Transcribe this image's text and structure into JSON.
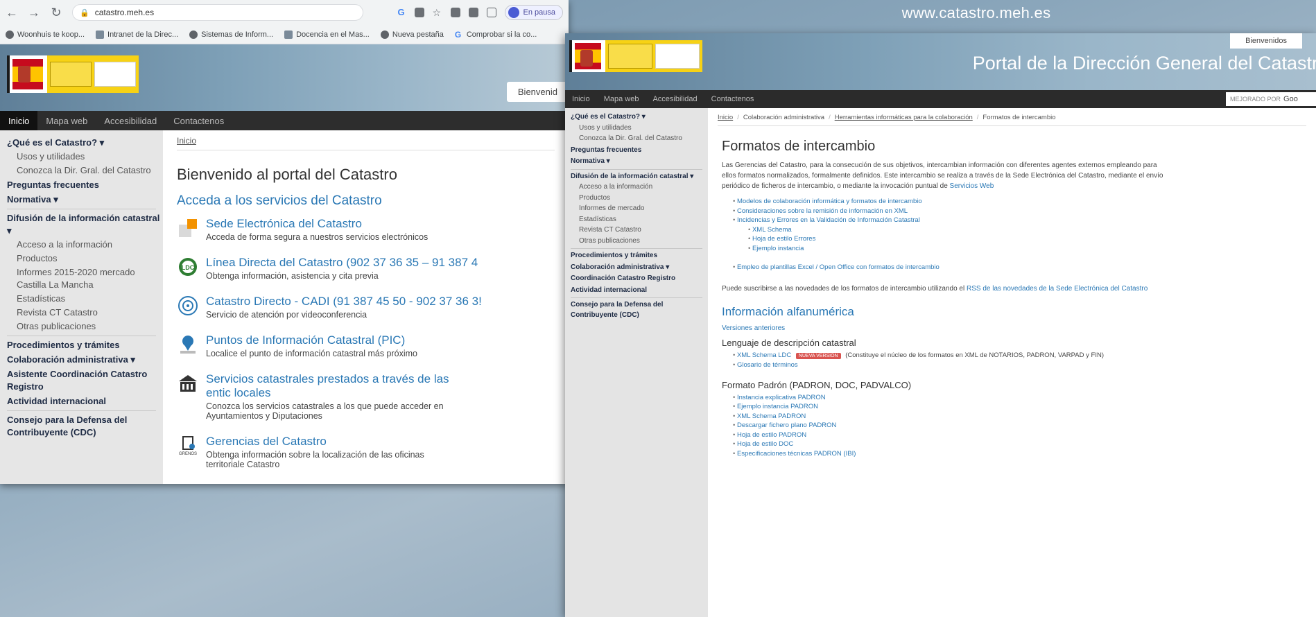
{
  "site_url": "www.catastro.meh.es",
  "browser": {
    "address": "catastro.meh.es",
    "profile_label": "En pausa",
    "bookmarks": [
      {
        "label": "Woonhuis te koop...",
        "icon": "globe-icon"
      },
      {
        "label": "Intranet de la Direc...",
        "icon": "intranet-icon"
      },
      {
        "label": "Sistemas de Inform...",
        "icon": "globe-icon"
      },
      {
        "label": "Docencia en el Mas...",
        "icon": "docencia-icon"
      },
      {
        "label": "Nueva pestaña",
        "icon": "globe-icon"
      },
      {
        "label": "Comprobar si la co...",
        "icon": "google-icon"
      }
    ]
  },
  "left_page": {
    "welcome_tab": "Bienvenid",
    "nav": [
      "Inicio",
      "Mapa web",
      "Accesibilidad",
      "Contactenos"
    ],
    "sidebar": [
      {
        "label": "¿Qué es el Catastro? ▾",
        "type": "heading"
      },
      {
        "label": "Usos y utilidades",
        "type": "sub"
      },
      {
        "label": "Conozca la Dir. Gral. del Catastro",
        "type": "sub"
      },
      {
        "label": "Preguntas frecuentes",
        "type": "heading"
      },
      {
        "label": "Normativa ▾",
        "type": "heading"
      },
      {
        "label": "",
        "type": "sep"
      },
      {
        "label": "Difusión de la información catastral ▾",
        "type": "heading"
      },
      {
        "label": "Acceso a la información",
        "type": "sub"
      },
      {
        "label": "Productos",
        "type": "sub"
      },
      {
        "label": "Informes 2015-2020 mercado Castilla La Mancha",
        "type": "sub"
      },
      {
        "label": "Estadísticas",
        "type": "sub"
      },
      {
        "label": "Revista CT Catastro",
        "type": "sub"
      },
      {
        "label": "Otras publicaciones",
        "type": "sub"
      },
      {
        "label": "",
        "type": "sep"
      },
      {
        "label": "Procedimientos y trámites",
        "type": "heading"
      },
      {
        "label": "Colaboración administrativa ▾",
        "type": "heading"
      },
      {
        "label": "Asistente Coordinación Catastro Registro",
        "type": "heading"
      },
      {
        "label": "Actividad internacional",
        "type": "heading"
      },
      {
        "label": "",
        "type": "sep"
      },
      {
        "label": "Consejo para la Defensa del Contribuyente (CDC)",
        "type": "heading"
      }
    ],
    "breadcrumb": "Inicio",
    "title": "Bienvenido al portal del Catastro",
    "subtitle": "Acceda a los servicios del Catastro",
    "services": [
      {
        "title": "Sede Electrónica del Catastro",
        "desc": "Acceda de forma segura a nuestros servicios electrónicos",
        "icon": "sede-icon"
      },
      {
        "title": "Línea Directa del Catastro (902 37 36 35 – 91 387 4",
        "desc": "Obtenga información, asistencia y cita previa",
        "icon": "ldc-icon"
      },
      {
        "title": "Catastro Directo - CADI (91 387 45 50 - 902 37 36 3!",
        "desc": "Servicio de atención por videoconferencia",
        "icon": "cadi-icon"
      },
      {
        "title": "Puntos de Información Catastral (PIC)",
        "desc": "Localice el punto de información catastral más próximo",
        "icon": "pic-icon"
      },
      {
        "title": "Servicios catastrales prestados a través de las entic locales",
        "desc": "Conozca los servicios catastrales a los que puede acceder en Ayuntamientos y Diputaciones",
        "icon": "building-icon",
        "wrap": true
      },
      {
        "title": "Gerencias del Catastro",
        "desc": "Obtenga información sobre la localización de las oficinas territoriale Catastro",
        "icon": "gerencias-icon",
        "wrap": true
      }
    ]
  },
  "right_page": {
    "welcome_tab": "Bienvenidos",
    "portal_title": "Portal de la Dirección General del Catastro",
    "nav": [
      "Inicio",
      "Mapa web",
      "Accesibilidad",
      "Contactenos"
    ],
    "search_label": "MEJORADO POR",
    "search_brand": "Goo",
    "sidebar": [
      {
        "label": "¿Qué es el Catastro? ▾",
        "type": "heading"
      },
      {
        "label": "Usos y utilidades",
        "type": "sub"
      },
      {
        "label": "Conozca la Dir. Gral. del Catastro",
        "type": "sub"
      },
      {
        "label": "Preguntas frecuentes",
        "type": "heading"
      },
      {
        "label": "Normativa ▾",
        "type": "heading"
      },
      {
        "label": "",
        "type": "sep"
      },
      {
        "label": "Difusión de la información catastral ▾",
        "type": "heading"
      },
      {
        "label": "Acceso a la información",
        "type": "sub"
      },
      {
        "label": "Productos",
        "type": "sub"
      },
      {
        "label": "Informes de mercado",
        "type": "sub"
      },
      {
        "label": "Estadísticas",
        "type": "sub"
      },
      {
        "label": "Revista CT Catastro",
        "type": "sub"
      },
      {
        "label": "Otras publicaciones",
        "type": "sub"
      },
      {
        "label": "",
        "type": "sep"
      },
      {
        "label": "Procedimientos y trámites",
        "type": "heading"
      },
      {
        "label": "Colaboración administrativa ▾",
        "type": "heading"
      },
      {
        "label": "Coordinación Catastro Registro",
        "type": "heading"
      },
      {
        "label": "Actividad internacional",
        "type": "heading"
      },
      {
        "label": "",
        "type": "sep"
      },
      {
        "label": "Consejo para la Defensa del Contribuyente (CDC)",
        "type": "heading"
      }
    ],
    "breadcrumbs": [
      "Inicio",
      "Colaboración administrativa",
      "Herramientas informáticas para la colaboración",
      "Formatos de intercambio"
    ],
    "title": "Formatos de intercambio",
    "intro": "Las Gerencias del Catastro, para la consecución de sus objetivos, intercambian información con diferentes agentes externos empleando para ellos formatos normalizados, formalmente definidos. Este intercambio se realiza a través de la Sede Electrónica del Catastro, mediante el envío periódico de ficheros de intercambio, o mediante la invocación puntual de",
    "intro_link": "Servicios Web",
    "links1": [
      {
        "label": "Modelos de colaboración informática y formatos de intercambio",
        "sub": false
      },
      {
        "label": "Consideraciones sobre la remisión de información en XML",
        "sub": false
      },
      {
        "label": "Incidencias y Errores en la Validación de Información Catastral",
        "sub": false
      },
      {
        "label": "XML Schema",
        "sub": true
      },
      {
        "label": "Hoja de estilo Errores",
        "sub": true
      },
      {
        "label": "Ejemplo instancia",
        "sub": true
      }
    ],
    "link_excel": "Empleo de plantillas Excel / Open Office con formatos de intercambio",
    "subscribe_pre": "Puede suscribirse a las novedades de los formatos de intercambio utilizando el",
    "subscribe_link": "RSS de las novedades de la Sede Electrónica del Catastro",
    "h2": "Información alfanumérica",
    "versions_link": "Versiones anteriores",
    "h3_ldc": "Lenguaje de descripción catastral",
    "ldc_link": "XML Schema LDC",
    "badge": "NUEVA VERSIÓN",
    "ldc_desc": "(Constituye el núcleo de los formatos en XML de NOTARIOS, PADRON, VARPAD y FIN)",
    "glosario": "Glosario de términos",
    "h3_padron": "Formato Padrón (PADRON, DOC, PADVALCO)",
    "padron_links": [
      "Instancia explicativa PADRON",
      "Ejemplo instancia PADRON",
      "XML Schema PADRON",
      "Descargar fichero plano PADRON",
      "Hoja de estilo PADRON",
      "Hoja de estilo DOC",
      "Especificaciones técnicas PADRON (IBI)"
    ]
  }
}
